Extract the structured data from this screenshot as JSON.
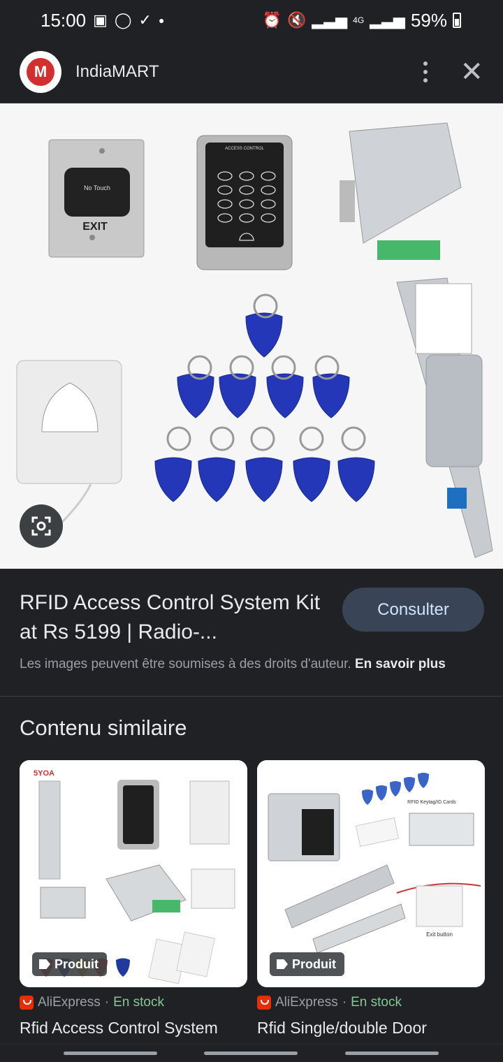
{
  "status_bar": {
    "time": "15:00",
    "network": "4G",
    "battery": "59%"
  },
  "header": {
    "site_name": "IndiaMART",
    "logo_letter": "M"
  },
  "result": {
    "title": "RFID Access Control System Kit at Rs 5199 | Radio-...",
    "consult_label": "Consulter",
    "notice_text": "Les images peuvent être soumises à des droits d'auteur.",
    "notice_link": "En savoir plus",
    "hero_labels": {
      "exit_button": "EXIT",
      "no_touch": "No Touch",
      "keypad_title": "ACCESS CONTROL"
    }
  },
  "similar": {
    "title": "Contenu similaire",
    "items": [
      {
        "badge": "Produit",
        "source": "AliExpress",
        "separator": "·",
        "stock": "En stock",
        "name": "Rfid Access Control System",
        "image_brand": "5YOA"
      },
      {
        "badge": "Produit",
        "source": "AliExpress",
        "separator": "·",
        "stock": "En stock",
        "name": "Rfid Single/double Door",
        "image_caption": "RFID Keytag/ID Cards",
        "image_exit_caption": "Exit button"
      }
    ]
  },
  "colors": {
    "background": "#202124",
    "consult_button": "#394457",
    "stock_green": "#81c995",
    "aliexpress_red": "#e62e04"
  }
}
